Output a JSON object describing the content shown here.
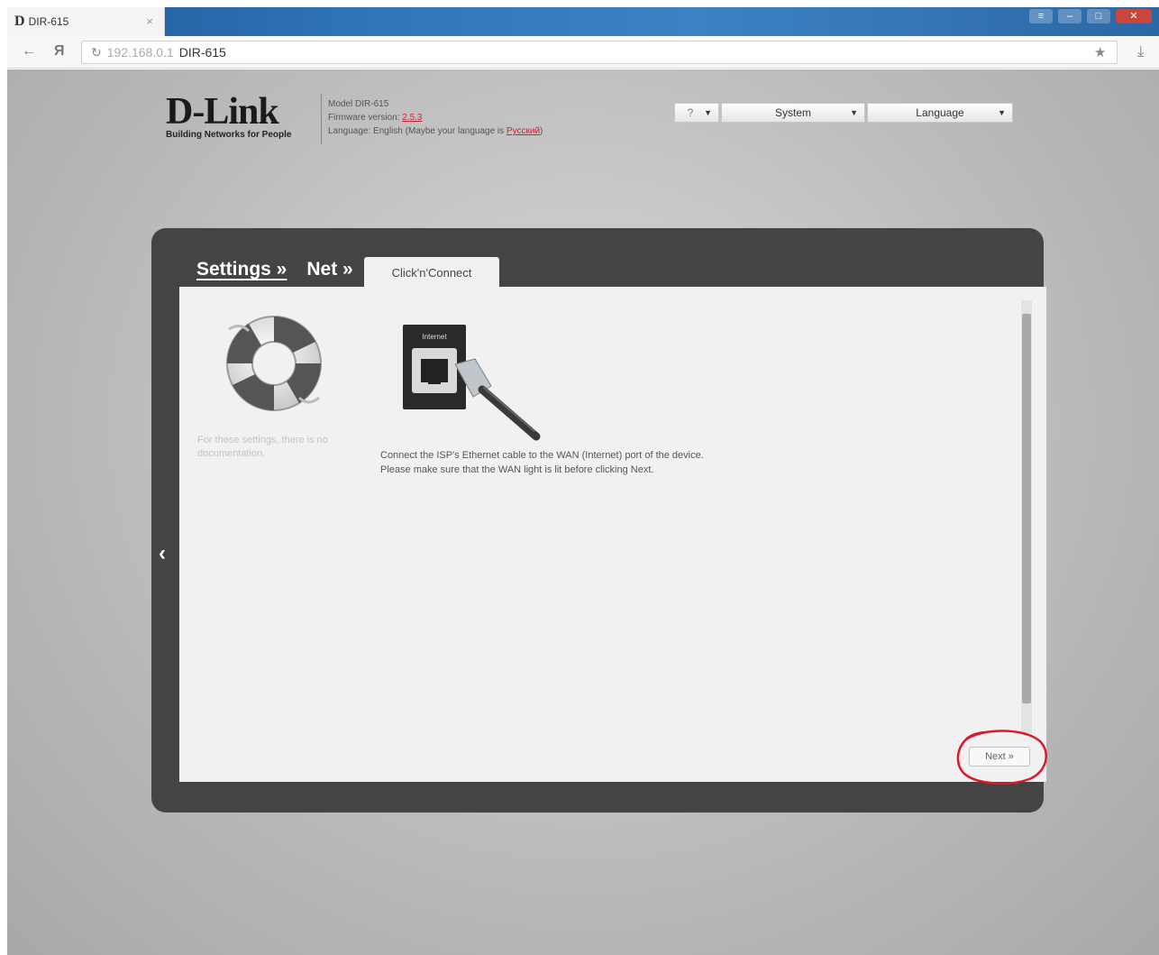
{
  "browser": {
    "tab_title": "DIR-615",
    "tab_close": "×",
    "url_host": "192.168.0.1",
    "page_title": "DIR-615"
  },
  "header": {
    "brand_name": "D-Link",
    "brand_tagline": "Building Networks for People",
    "model_line": "Model DIR-615",
    "firmware_label": "Firmware version:",
    "firmware_value": "2.5.3",
    "language_line": "Language: English (Maybe your language is",
    "language_link": "Русский",
    "language_close": ")"
  },
  "topmenu": {
    "help_icon": "?",
    "system": "System",
    "language": "Language"
  },
  "breadcrumb": {
    "settings": "Settings »",
    "net": "Net »",
    "active_tab": "Click'n'Connect"
  },
  "sidebar": {
    "doc_note": "For these settings, there is no documentation."
  },
  "main": {
    "instruction_line1": "Connect the ISP's Ethernet cable to the WAN (Internet) port of the device.",
    "instruction_line2": "Please make sure that the WAN light is lit before clicking Next.",
    "cable_label": "Internet",
    "next_label": "Next »"
  },
  "colors": {
    "panel": "#444444",
    "content": "#f1f1f1",
    "highlight": "#e0162b"
  }
}
